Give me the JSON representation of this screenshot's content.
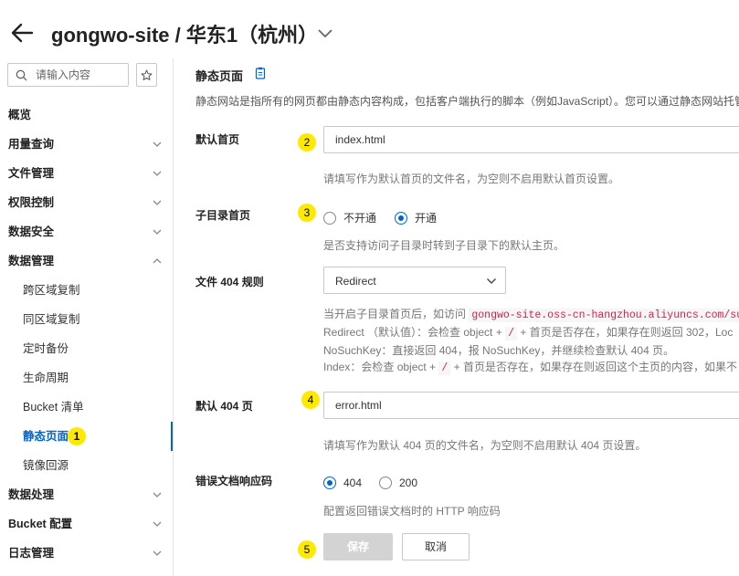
{
  "header": {
    "title": "gongwo-site / 华东1（杭州）"
  },
  "sidebar": {
    "search_placeholder": "请输入内容",
    "items": [
      {
        "label": "概览"
      },
      {
        "label": "用量查询"
      },
      {
        "label": "文件管理"
      },
      {
        "label": "权限控制"
      },
      {
        "label": "数据安全"
      },
      {
        "label": "数据管理"
      },
      {
        "label": "跨区域复制"
      },
      {
        "label": "同区域复制"
      },
      {
        "label": "定时备份"
      },
      {
        "label": "生命周期"
      },
      {
        "label": "Bucket 清单"
      },
      {
        "label": "静态页面"
      },
      {
        "label": "镜像回源"
      },
      {
        "label": "数据处理"
      },
      {
        "label": "Bucket 配置"
      },
      {
        "label": "日志管理"
      }
    ]
  },
  "badges": [
    "1",
    "2",
    "3",
    "4",
    "5"
  ],
  "content": {
    "section_title": "静态页面",
    "intro": "静态网站是指所有的网页都由静态内容构成，包括客户端执行的脚本（例如JavaScript）。您可以通过静态网站托管",
    "default_index": {
      "label": "默认首页",
      "value": "index.html",
      "hint": "请填写作为默认首页的文件名，为空则不启用默认首页设置。"
    },
    "subdir_index": {
      "label": "子目录首页",
      "options": [
        "不开通",
        "开通"
      ],
      "selected": "开通",
      "hint": "是否支持访问子目录时转到子目录下的默认主页。"
    },
    "rule_404": {
      "label": "文件 404 规则",
      "value": "Redirect",
      "desc_line1_prefix": "当开启子目录首页后，如访问",
      "desc_line1_code": "gongwo-site.oss-cn-hangzhou.aliyuncs.com/subd",
      "desc_line2_a": "Redirect （默认值）：会检查 object +",
      "desc_slash": "/",
      "desc_line2_b": "+ 首页是否存在，如果存在则返回 302，Loc",
      "desc_line3": "NoSuchKey：直接返回 404，报 NoSuchKey，并继续检查默认 404 页。",
      "desc_line4_a": "Index：会检查 object +",
      "desc_line4_b": "+ 首页是否存在，如果存在则返回这个主页的内容，如果不"
    },
    "default_404": {
      "label": "默认 404 页",
      "value": "error.html",
      "hint": "请填写作为默认 404 页的文件名，为空则不启用默认 404 页设置。"
    },
    "error_code": {
      "label": "错误文档响应码",
      "options": [
        "404",
        "200"
      ],
      "selected": "404",
      "hint": "配置返回错误文档时的 HTTP 响应码"
    },
    "save_label": "保存",
    "cancel_label": "取消"
  },
  "colors": {
    "primary": "#0064c8",
    "badge": "#ffe900"
  }
}
